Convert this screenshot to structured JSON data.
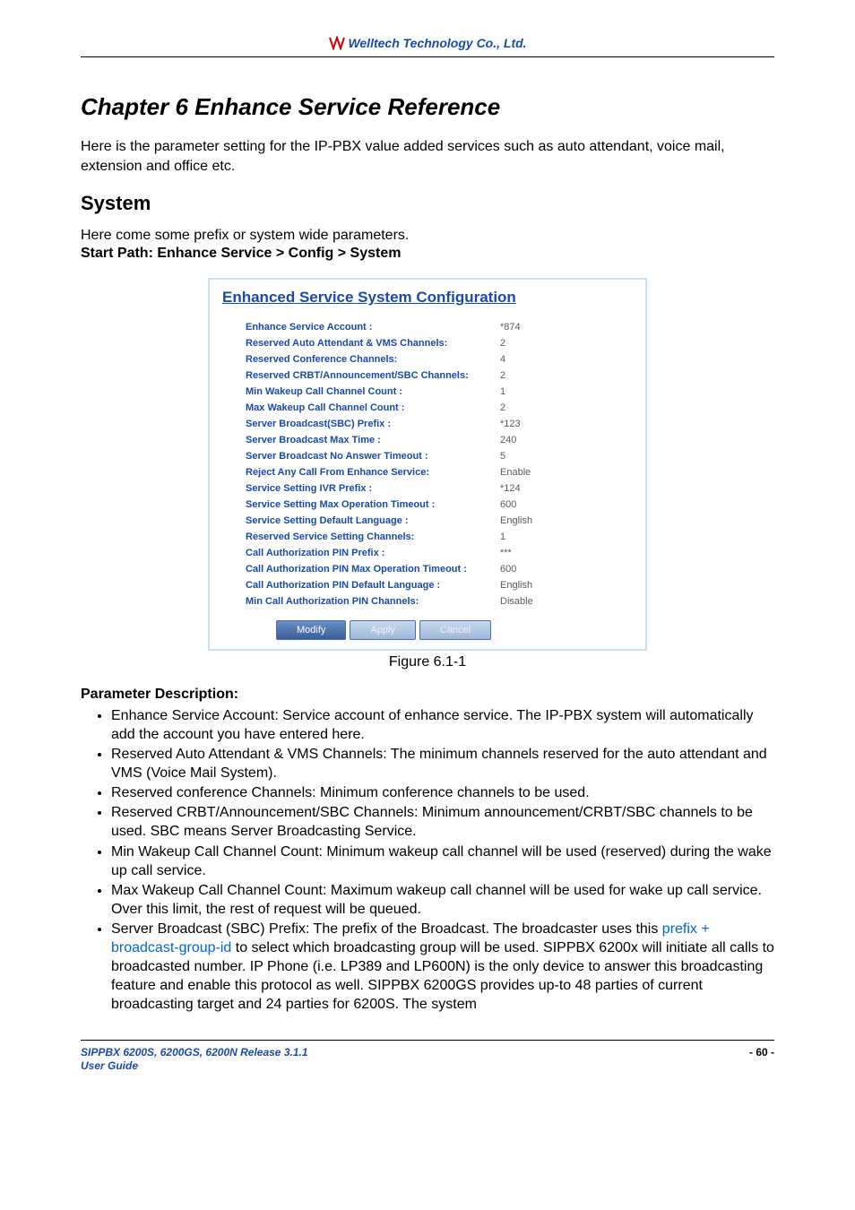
{
  "header": {
    "brand": "Welltech Technology Co., Ltd."
  },
  "chapter": {
    "title": "Chapter 6 Enhance Service Reference"
  },
  "intro": "Here is the parameter setting for the IP-PBX value added services such as auto attendant, voice mail, extension and office etc.",
  "section": {
    "title": "System",
    "lead": "Here come some prefix or system wide parameters.",
    "path": "Start Path: Enhance Service > Config > System"
  },
  "screenshot": {
    "title": "Enhanced Service System Configuration",
    "rows": [
      {
        "label": "Enhance Service Account :",
        "value": "*874"
      },
      {
        "label": "Reserved Auto Attendant & VMS Channels:",
        "value": "2"
      },
      {
        "label": "Reserved Conference Channels:",
        "value": "4"
      },
      {
        "label": "Reserved CRBT/Announcement/SBC Channels:",
        "value": "2"
      },
      {
        "label": "Min Wakeup Call Channel Count :",
        "value": "1"
      },
      {
        "label": "Max Wakeup Call Channel Count :",
        "value": "2"
      },
      {
        "label": "Server Broadcast(SBC) Prefix :",
        "value": "*123"
      },
      {
        "label": "Server Broadcast Max Time :",
        "value": "240"
      },
      {
        "label": "Server Broadcast No Answer Timeout :",
        "value": "5"
      },
      {
        "label": "Reject Any Call From Enhance Service:",
        "value": "Enable"
      },
      {
        "label": "Service Setting IVR Prefix :",
        "value": "*124"
      },
      {
        "label": "Service Setting Max Operation Timeout :",
        "value": "600"
      },
      {
        "label": "Service Setting Default Language :",
        "value": "English"
      },
      {
        "label": "Reserved Service Setting Channels:",
        "value": "1"
      },
      {
        "label": "Call Authorization PIN Prefix :",
        "value": "***"
      },
      {
        "label": "Call Authorization PIN Max Operation Timeout :",
        "value": "600"
      },
      {
        "label": "Call Authorization PIN Default Language :",
        "value": "English"
      },
      {
        "label": "Min Call Authorization PIN Channels:",
        "value": "Disable"
      }
    ],
    "buttons": {
      "modify": "Modify",
      "apply": "Apply",
      "cancel": "Cancel"
    },
    "caption": "Figure 6.1-1"
  },
  "params": {
    "heading": "Parameter Description:",
    "items": [
      "Enhance Service Account: Service account of enhance service. The IP-PBX system will automatically add the account you have entered here.",
      "Reserved Auto Attendant & VMS Channels: The minimum channels reserved for the auto attendant and VMS (Voice Mail System).",
      "Reserved conference Channels: Minimum conference channels to be used.",
      "Reserved CRBT/Announcement/SBC Channels: Minimum announcement/CRBT/SBC channels to be used. SBC means Server Broadcasting Service.",
      "Min Wakeup Call Channel Count: Minimum wakeup call channel will be used (reserved) during the wake up call service.",
      "Max Wakeup Call Channel Count: Maximum wakeup call channel will be used for wake up call service. Over this limit, the rest of request will be queued."
    ],
    "sbc_pre": "Server Broadcast (SBC) Prefix: The prefix of the Broadcast. The broadcaster uses this ",
    "sbc_highlight": "prefix + broadcast-group-id",
    "sbc_post": " to select which broadcasting group will be used. SIPPBX 6200x will initiate all calls to broadcasted number. IP Phone (i.e. LP389 and LP600N) is the only device to answer this broadcasting feature and enable this protocol as well. SIPPBX 6200GS provides up-to 48 parties of current broadcasting target and 24 parties for 6200S. The system"
  },
  "footer": {
    "line1": "SIPPBX 6200S, 6200GS, 6200N   Release 3.1.1",
    "line2": "User Guide",
    "page": "- 60 -"
  }
}
